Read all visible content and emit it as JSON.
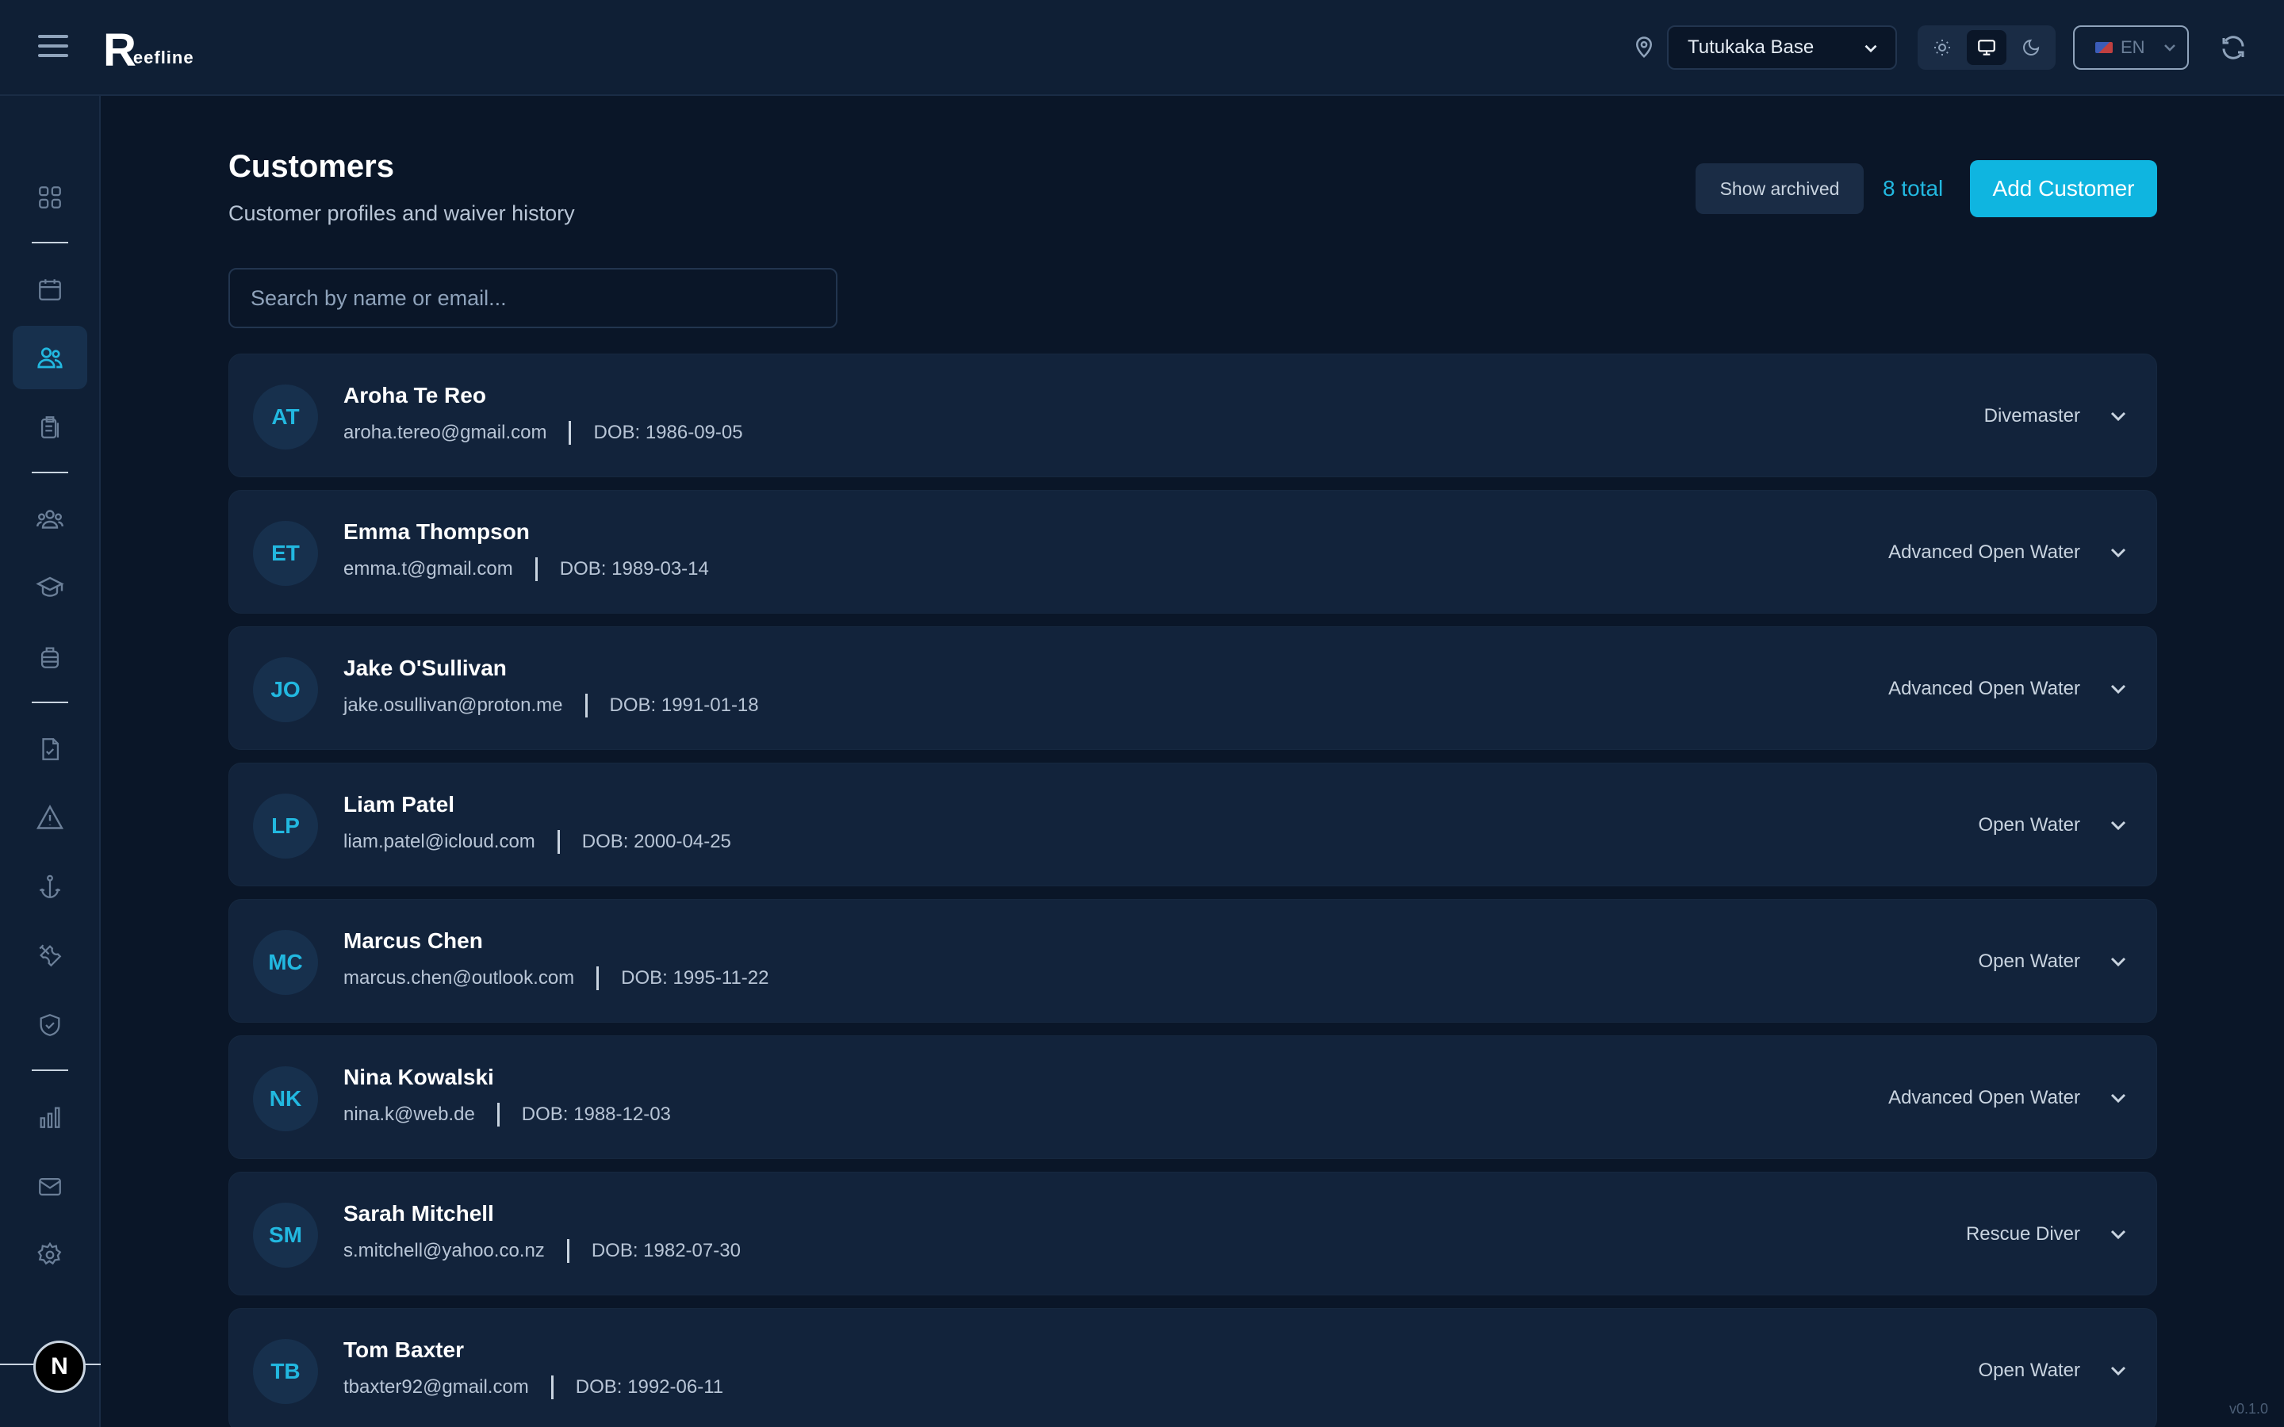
{
  "app": {
    "logo_letter": "R",
    "logo_text": "eefline",
    "version": "v0.1.0"
  },
  "header": {
    "location": "Tutukaka Base",
    "language": "EN"
  },
  "sidebar": {
    "user_initial": "N"
  },
  "page": {
    "title": "Customers",
    "subtitle": "Customer profiles and waiver history",
    "show_archived_label": "Show archived",
    "total_label": "8 total",
    "add_button_label": "Add Customer",
    "search_placeholder": "Search by name or email..."
  },
  "customers": [
    {
      "initials": "AT",
      "name": "Aroha Te Reo",
      "email": "aroha.tereo@gmail.com",
      "dob": "DOB: 1986-09-05",
      "cert": "Divemaster"
    },
    {
      "initials": "ET",
      "name": "Emma Thompson",
      "email": "emma.t@gmail.com",
      "dob": "DOB: 1989-03-14",
      "cert": "Advanced Open Water"
    },
    {
      "initials": "JO",
      "name": "Jake O'Sullivan",
      "email": "jake.osullivan@proton.me",
      "dob": "DOB: 1991-01-18",
      "cert": "Advanced Open Water"
    },
    {
      "initials": "LP",
      "name": "Liam Patel",
      "email": "liam.patel@icloud.com",
      "dob": "DOB: 2000-04-25",
      "cert": "Open Water"
    },
    {
      "initials": "MC",
      "name": "Marcus Chen",
      "email": "marcus.chen@outlook.com",
      "dob": "DOB: 1995-11-22",
      "cert": "Open Water"
    },
    {
      "initials": "NK",
      "name": "Nina Kowalski",
      "email": "nina.k@web.de",
      "dob": "DOB: 1988-12-03",
      "cert": "Advanced Open Water"
    },
    {
      "initials": "SM",
      "name": "Sarah Mitchell",
      "email": "s.mitchell@yahoo.co.nz",
      "dob": "DOB: 1982-07-30",
      "cert": "Rescue Diver"
    },
    {
      "initials": "TB",
      "name": "Tom Baxter",
      "email": "tbaxter92@gmail.com",
      "dob": "DOB: 1992-06-11",
      "cert": "Open Water"
    }
  ]
}
